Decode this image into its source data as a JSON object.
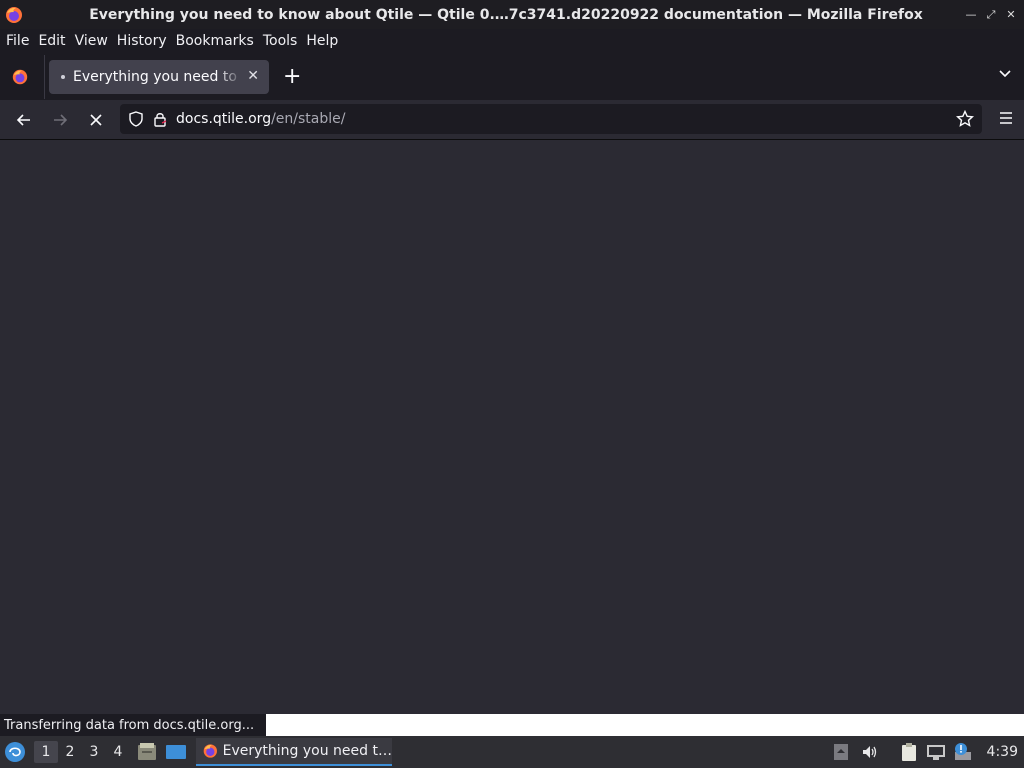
{
  "window": {
    "title": "Everything you need to know about Qtile — Qtile 0.…7c3741.d20220922 documentation — Mozilla Firefox"
  },
  "menubar": {
    "items": [
      "File",
      "Edit",
      "View",
      "History",
      "Bookmarks",
      "Tools",
      "Help"
    ]
  },
  "tabs": [
    {
      "label": "Everything you need to know about Qtile",
      "loading": true,
      "close_icon": "close-icon"
    }
  ],
  "navbar": {
    "url_host": "docs.qtile.org",
    "url_path": "/en/stable/"
  },
  "status": {
    "text": "Transferring data from docs.qtile.org..."
  },
  "taskbar": {
    "workspaces": [
      "1",
      "2",
      "3",
      "4"
    ],
    "active_workspace": "1",
    "task_label": "Everything you need t…",
    "clock": "4:39"
  },
  "colors": {
    "accent": "#3d8fd8",
    "content_bg": "#2b2a33",
    "chrome_bg": "#1c1b22"
  }
}
